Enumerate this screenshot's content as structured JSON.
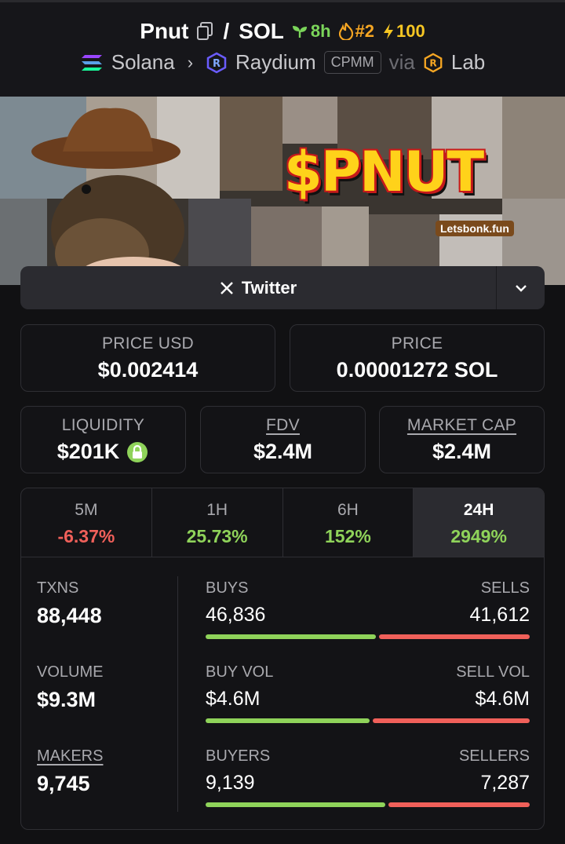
{
  "header": {
    "token": "Pnut",
    "quote": "SOL",
    "age": "8h",
    "rank": "#2",
    "boosts": "100",
    "chain": "Solana",
    "dex": "Raydium",
    "pool_type": "CPMM",
    "via_label": "via",
    "launchpad": "Lab"
  },
  "banner": {
    "headline": "$PNUT",
    "caption": "Letsbonk.fun",
    "image_desc": "squirrel in cowboy hat collage"
  },
  "socials": {
    "twitter_label": "Twitter"
  },
  "price": {
    "usd_label": "PRICE USD",
    "usd_value": "$0.002414",
    "native_label": "PRICE",
    "native_value": "0.00001272 SOL"
  },
  "metrics": {
    "liquidity_label": "LIQUIDITY",
    "liquidity_value": "$201K",
    "fdv_label": "FDV",
    "fdv_value": "$2.4M",
    "mcap_label": "MARKET CAP",
    "mcap_value": "$2.4M"
  },
  "timeframes": [
    {
      "label": "5M",
      "change": "-6.37%"
    },
    {
      "label": "1H",
      "change": "25.73%"
    },
    {
      "label": "6H",
      "change": "152%"
    },
    {
      "label": "24H",
      "change": "2949%"
    }
  ],
  "active_timeframe": "24H",
  "stats": {
    "txns_label": "TXNS",
    "txns_value": "88,448",
    "volume_label": "VOLUME",
    "volume_value": "$9.3M",
    "makers_label": "MAKERS",
    "makers_value": "9,745",
    "buys_label": "BUYS",
    "buys_value": "46,836",
    "sells_label": "SELLS",
    "sells_value": "41,612",
    "buy_vol_label": "BUY VOL",
    "buy_vol_value": "$4.6M",
    "sell_vol_label": "SELL VOL",
    "sell_vol_value": "$4.6M",
    "buyers_label": "BUYERS",
    "buyers_value": "9,139",
    "sellers_label": "SELLERS",
    "sellers_value": "7,287",
    "buy_ratio_txns": 0.53,
    "buy_ratio_vol": 0.51,
    "buy_ratio_makers": 0.56
  },
  "colors": {
    "positive": "#8fd35a",
    "negative": "#f0605a",
    "background": "#111113"
  }
}
